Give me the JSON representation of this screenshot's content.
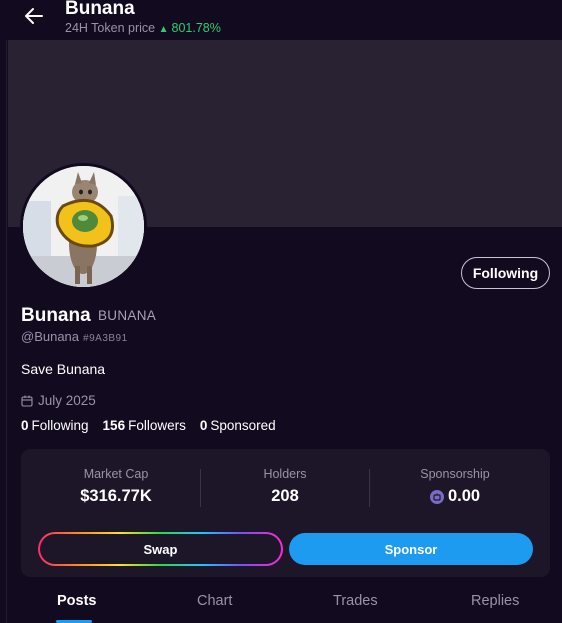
{
  "header": {
    "title": "Bunana",
    "price_label": "24H Token price",
    "price_change": "801.78%",
    "price_direction_icon": "triangle-up-icon"
  },
  "profile": {
    "name": "Bunana",
    "ticker": "BUNANA",
    "handle": "@Bunana",
    "address_short": "#9A3B91",
    "bio": "Save Bunana",
    "joined": "July 2025",
    "follow_button_label": "Following",
    "stats": {
      "following_count": "0",
      "following_label": "Following",
      "followers_count": "156",
      "followers_label": "Followers",
      "sponsored_count": "0",
      "sponsored_label": "Sponsored"
    }
  },
  "market": {
    "market_cap_label": "Market Cap",
    "market_cap_value": "$316.77K",
    "holders_label": "Holders",
    "holders_value": "208",
    "sponsorship_label": "Sponsorship",
    "sponsorship_value": "0.00",
    "swap_label": "Swap",
    "sponsor_label": "Sponsor"
  },
  "tabs": [
    {
      "label": "Posts",
      "active": true
    },
    {
      "label": "Chart",
      "active": false
    },
    {
      "label": "Trades",
      "active": false
    },
    {
      "label": "Replies",
      "active": false
    }
  ],
  "colors": {
    "background": "#120a1e",
    "banner": "#282233",
    "card": "#1d1629",
    "accent_blue": "#1d9bf0",
    "positive_green": "#2ecc71"
  }
}
